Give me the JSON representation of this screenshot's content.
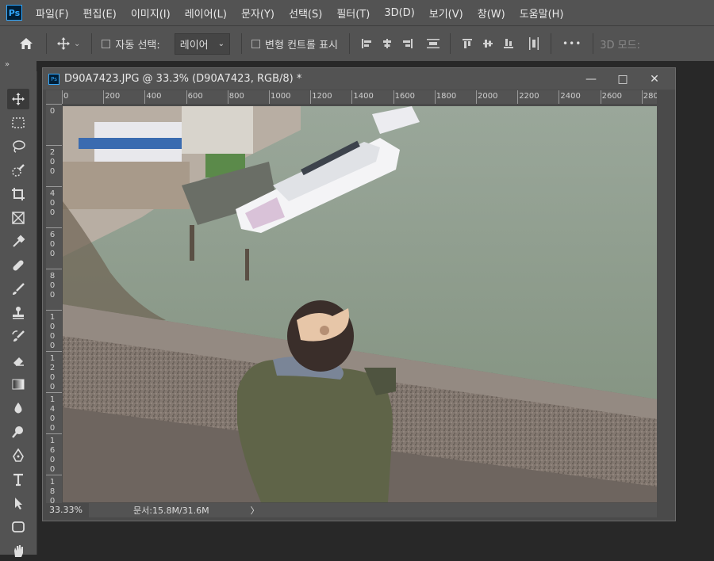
{
  "app": {
    "logo": "Ps"
  },
  "menu": [
    "파일(F)",
    "편집(E)",
    "이미지(I)",
    "레이어(L)",
    "문자(Y)",
    "선택(S)",
    "필터(T)",
    "3D(D)",
    "보기(V)",
    "창(W)",
    "도움말(H)"
  ],
  "options": {
    "auto_select_label": "자동 선택:",
    "layer_select_value": "레이어",
    "transform_label": "변형 컨트롤 표시",
    "mode_3d_label": "3D 모드:",
    "more_glyph": "•••"
  },
  "panel_collapse_glyph": "»",
  "document": {
    "ps_badge": "Ps",
    "title": "D90A7423.JPG @ 33.3% (D90A7423, RGB/8) *",
    "minimize": "—",
    "maximize": "□",
    "close": "✕"
  },
  "ruler_h": [
    "0",
    "200",
    "400",
    "600",
    "800",
    "1000",
    "1200",
    "1400",
    "1600",
    "1800",
    "2000",
    "2200",
    "2400",
    "2600",
    "280"
  ],
  "ruler_v": [
    "0",
    "200",
    "400",
    "600",
    "800",
    "1000",
    "1200",
    "1400",
    "1600",
    "1800"
  ],
  "status": {
    "zoom": "33.33%",
    "doc_info": "문서:15.8M/31.6M",
    "arrow": "〉"
  },
  "icons": {
    "home": "home-icon",
    "move": "move-icon",
    "tools": [
      "move-tool-icon",
      "marquee-tool-icon",
      "lasso-tool-icon",
      "quick-select-tool-icon",
      "crop-tool-icon",
      "frame-tool-icon",
      "eyedropper-tool-icon",
      "healing-brush-tool-icon",
      "brush-tool-icon",
      "stamp-tool-icon",
      "history-brush-tool-icon",
      "eraser-tool-icon",
      "gradient-tool-icon",
      "blur-tool-icon",
      "dodge-tool-icon",
      "pen-tool-icon",
      "type-tool-icon",
      "path-select-tool-icon",
      "shape-tool-icon",
      "hand-tool-icon"
    ]
  },
  "colors": {
    "ui_bg": "#535353",
    "workspace": "#282828",
    "accent": "#31a8ff"
  }
}
